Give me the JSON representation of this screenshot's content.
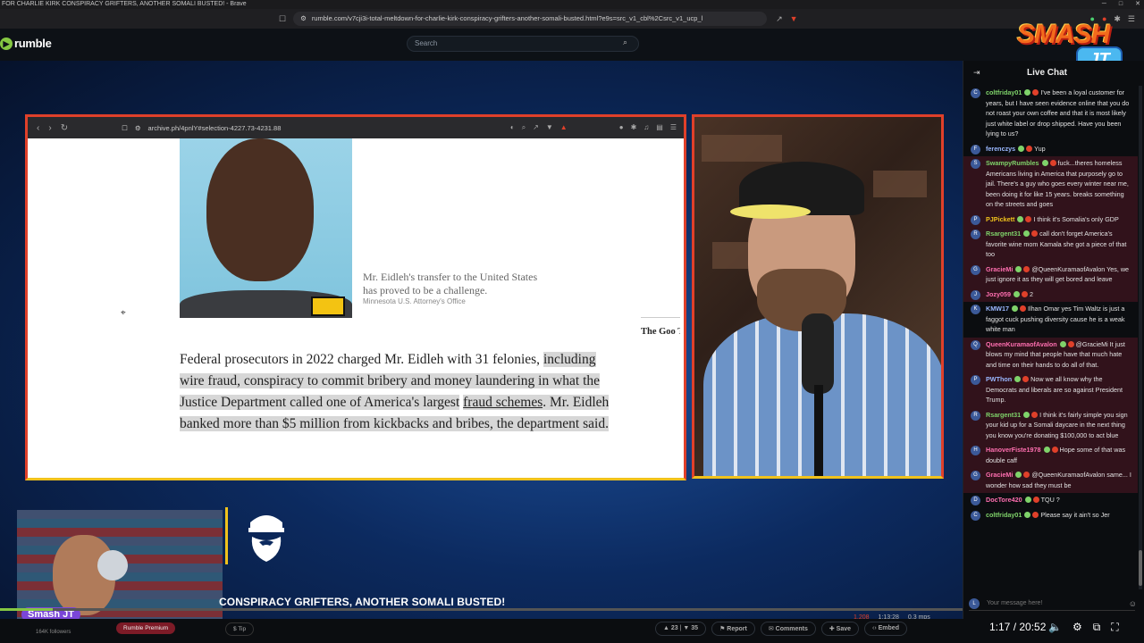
{
  "window": {
    "title": "FOR CHARLIE KIRK CONSPIRACY GRIFTERS, ANOTHER SOMALI BUSTED! - Brave",
    "url": "rumble.com/v7cji3i-total-meltdown-for-charlie-kirk-conspiracy-grifters-another-somali-busted.html?e9s=src_v1_cbl%2Csrc_v1_ucp_l"
  },
  "header": {
    "logo_text": "rumble",
    "search_placeholder": "Search"
  },
  "share": {
    "url": "archive.ph/4pnlY#selection-4227.73-4231.88",
    "caption": "Mr. Eidleh's transfer to the United States has proved to be a challenge.",
    "credit": "Minnesota U.S. Attorney's Office",
    "teaser": "The Goo Things t Delight",
    "para_1": "Federal prosecutors in 2022 charged Mr. Eidleh with 31 felonies,",
    "para_2": "including wire fraud, conspiracy to commit bribery and money laundering in what the Justice Department called one of America's largest",
    "para_link": "fraud schemes",
    "para_3": ". Mr. Eidleh banked more than $5 million from kickbacks and bribes, the department said."
  },
  "overlay": {
    "guest_name": "Smash JT",
    "video_title": "CONSPIRACY GRIFTERS, ANOTHER SOMALI BUSTED!",
    "logo_smash": "SMASH",
    "logo_jt": "JT"
  },
  "player": {
    "progress": 0.055,
    "watching": "1,208",
    "duration_live": "1:13:28",
    "bitrate": "0.3 mps",
    "time": "1:17 / 20:52"
  },
  "below": {
    "followers": "164K followers",
    "premium": "Rumble Premium",
    "tip": "Tip",
    "likes": "23",
    "dislikes": "35",
    "report": "Report",
    "comments": "Comments",
    "save": "Save",
    "embed": "Embed"
  },
  "chat": {
    "title": "Live Chat",
    "input_placeholder": "Your message here!",
    "messages": [
      {
        "user": "coltfriday01",
        "text": "I've been a loyal customer for years, but I have seen evidence online that you do not roast your own coffee and that it is most likely just white label or drop shipped. Have you been lying to us?",
        "color": "#7fd36a",
        "hl": false,
        "av": "C"
      },
      {
        "user": "ferenczys",
        "text": "Yup",
        "color": "#9ab8ff",
        "hl": false,
        "av": "F"
      },
      {
        "user": "SwampyRumbles",
        "text": "fuck...theres homeless Americans living in America that purposely go to jail. There's a guy who goes every winter near me, been doing it for like 15 years. breaks something on the streets and goes",
        "color": "#7fd36a",
        "hl": true,
        "av": "S"
      },
      {
        "user": "PJPickett",
        "text": "I think it's Somalia's only GDP",
        "color": "#f0c21c",
        "hl": true,
        "av": "P"
      },
      {
        "user": "Rsargent31",
        "text": "call don't forget America's favorite wine mom Kamala she got a piece of that too",
        "color": "#7fd36a",
        "hl": true,
        "av": "R"
      },
      {
        "user": "GracieMi",
        "text": "@QueenKuramaofAvalon Yes, we just ignore it as they will get bored and leave",
        "color": "#ff6fb0",
        "hl": true,
        "av": "G"
      },
      {
        "user": "Jozy059",
        "text": "2",
        "color": "#ff6fb0",
        "hl": true,
        "av": "J"
      },
      {
        "user": "KMW17",
        "text": "Ilhan Omar yes Tim Waltz is just a faggot cuck pushing diversity cause he is a weak white man",
        "color": "#9ab8ff",
        "hl": false,
        "av": "K"
      },
      {
        "user": "QueenKuramaofAvalon",
        "text": "@GracieMi It just blows my mind that people have that much hate and time on their hands to do all of that.",
        "color": "#ff6fb0",
        "hl": true,
        "av": "Q"
      },
      {
        "user": "PWThon",
        "text": "Now we all know why the Democrats and liberals are so against President Trump.",
        "color": "#9ab8ff",
        "hl": true,
        "av": "P"
      },
      {
        "user": "Rsargent31",
        "text": "I think it's fairly simple you sign your kid up for a Somali daycare in the next thing you know you're donating $100,000 to act blue",
        "color": "#7fd36a",
        "hl": true,
        "av": "R"
      },
      {
        "user": "HanoverFiste1978",
        "text": "Hope some of that was double caff",
        "color": "#ff6fb0",
        "hl": true,
        "av": "H"
      },
      {
        "user": "GracieMi",
        "text": "@QueenKuramaofAvalon same... I wonder how sad they must be",
        "color": "#ff6fb0",
        "hl": true,
        "av": "G"
      },
      {
        "user": "DocTore420",
        "text": "TQU ?",
        "color": "#ff6fb0",
        "hl": false,
        "av": "D"
      },
      {
        "user": "coltfriday01",
        "text": "Please say it ain't so Jer",
        "color": "#7fd36a",
        "hl": false,
        "av": "C"
      }
    ]
  }
}
